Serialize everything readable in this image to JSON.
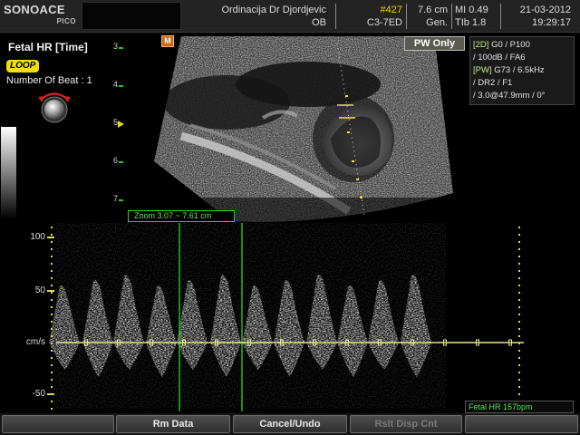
{
  "header": {
    "logo_main": "SONOACE",
    "logo_sub": "PICO",
    "clinic_name": "Ordinacija Dr Djordjevic",
    "department": "OB",
    "study_number": "#427",
    "probe": "C3-7ED",
    "depth": "7.6 cm",
    "preset": "Gen.",
    "mi": "MI 0.49",
    "tib": "TIb  1.8",
    "date": "21-03-2012",
    "time": "19:29:17"
  },
  "left_panel": {
    "measurement_title": "Fetal HR [Time]",
    "loop_label": "LOOP",
    "beats_label": "Number Of Beat : 1",
    "knob_icon": "trackball-knob-icon"
  },
  "depth_scale": {
    "labels": [
      "3",
      "4",
      "5",
      "6",
      "7"
    ],
    "focus_depth": "5"
  },
  "marker": "M",
  "mode_badge": "PW Only",
  "params": {
    "line1_tag": "[2D]",
    "line1": "G0 / P100",
    "line2": "/ 100dB / FA6",
    "line3_tag": "[PW]",
    "line3": "G73 / 6.5kHz",
    "line4": "/ DR2 / F1",
    "line5": "/ 3.0@47.9mm / 0°"
  },
  "zoom": "Zoom 3.07 ~ 7.61 cm",
  "doppler": {
    "scale_labels": [
      "100",
      "50",
      "cm/s",
      "-50"
    ],
    "unit": "cm/s"
  },
  "hr_readout": "Fetal HR 157bpm",
  "softkeys": [
    "",
    "Rm Data",
    "Cancel/Undo",
    "Rslt Disp Cnt",
    ""
  ],
  "colors": {
    "accent_green": "#26d226",
    "accent_yellow": "#f0d000",
    "loop_badge": "#f2e100"
  }
}
